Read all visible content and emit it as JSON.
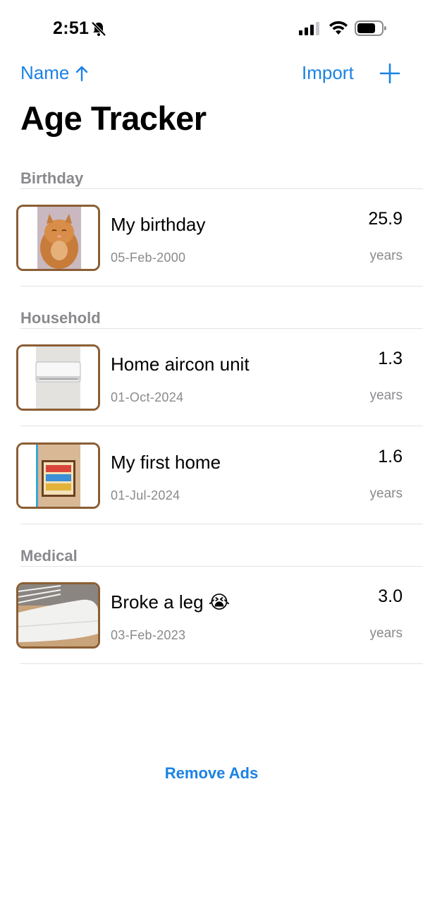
{
  "status_bar": {
    "time": "2:51"
  },
  "nav": {
    "sort_label": "Name",
    "import_label": "Import"
  },
  "title": "Age Tracker",
  "sections": [
    {
      "header": "Birthday",
      "items": [
        {
          "title": "My birthday",
          "date": "05-Feb-2000",
          "value": "25.9",
          "unit": "years",
          "image": "cat-photo"
        }
      ]
    },
    {
      "header": "Household",
      "items": [
        {
          "title": "Home aircon unit",
          "date": "01-Oct-2024",
          "value": "1.3",
          "unit": "years",
          "image": "aircon-photo"
        },
        {
          "title": "My first home",
          "date": "01-Jul-2024",
          "value": "1.6",
          "unit": "years",
          "image": "home-sign-photo"
        }
      ]
    },
    {
      "header": "Medical",
      "items": [
        {
          "title": "Broke a leg 😭",
          "date": "03-Feb-2023",
          "value": "3.0",
          "unit": "years",
          "image": "leg-cast-photo"
        }
      ]
    }
  ],
  "footer": {
    "remove_ads": "Remove Ads"
  },
  "colors": {
    "accent": "#1c82e5",
    "thumb_border": "#8b5e34",
    "secondary_text": "#8a8a8e"
  }
}
